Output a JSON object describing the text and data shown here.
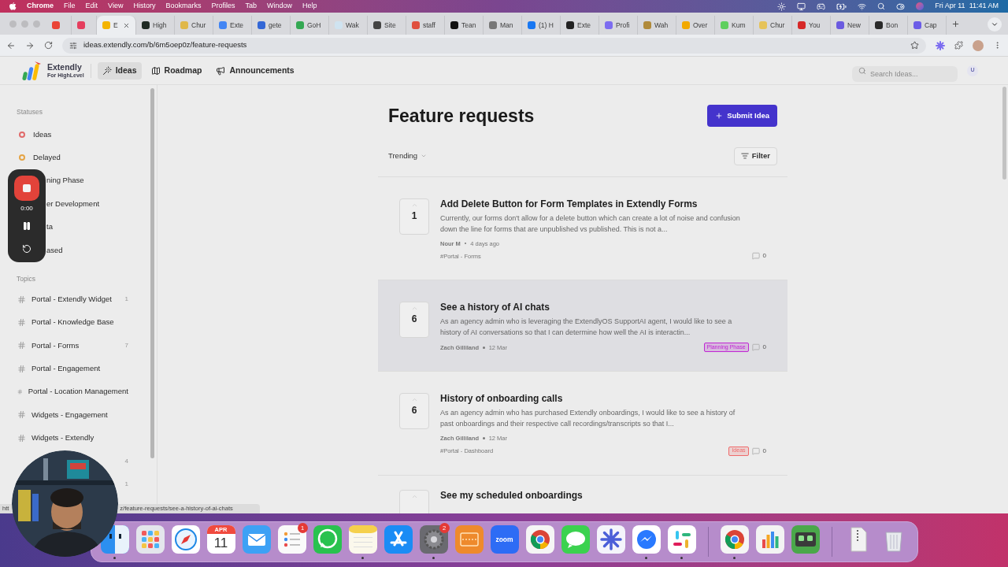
{
  "menu_bar": {
    "app": "Chrome",
    "menus": [
      "File",
      "Edit",
      "View",
      "History",
      "Bookmarks",
      "Profiles",
      "Tab",
      "Window",
      "Help"
    ],
    "clock": "Fri Apr 11  11:41 AM"
  },
  "tabs": [
    {
      "selected": false,
      "color": "#ea4335"
    },
    {
      "selected": false,
      "color": "#e53e5e"
    },
    {
      "title": "E",
      "selected": true,
      "color": "#f4b400"
    },
    {
      "title": "High",
      "selected": false,
      "color": "#1f2a24"
    },
    {
      "title": "Chur",
      "selected": false,
      "color": "#e0b84a"
    },
    {
      "title": "Exte",
      "selected": false,
      "color": "#4285f4"
    },
    {
      "title": "gete",
      "selected": false,
      "color": "#3367d6"
    },
    {
      "title": "GoH",
      "selected": false,
      "color": "#34a853"
    },
    {
      "title": "Wak",
      "selected": false,
      "color": "#cfe3f0"
    },
    {
      "title": "Site",
      "selected": false,
      "color": "#444444"
    },
    {
      "title": "staff",
      "selected": false,
      "color": "#e0503f"
    },
    {
      "title": "Tean",
      "selected": false,
      "color": "#111111"
    },
    {
      "title": "Man",
      "selected": false,
      "color": "#777777"
    },
    {
      "title": "(1) H",
      "selected": false,
      "color": "#1877f2"
    },
    {
      "title": "Exte",
      "selected": false,
      "color": "#222222"
    },
    {
      "title": "Profi",
      "selected": false,
      "color": "#7c6cf0"
    },
    {
      "title": "Wah",
      "selected": false,
      "color": "#b08a3a"
    },
    {
      "title": "Over",
      "selected": false,
      "color": "#f2a900"
    },
    {
      "title": "Kum",
      "selected": false,
      "color": "#5ecf5e"
    },
    {
      "title": "Chur",
      "selected": false,
      "color": "#e6c35a"
    },
    {
      "title": "You",
      "selected": false,
      "color": "#d62828"
    },
    {
      "title": "New",
      "selected": false,
      "color": "#6a5ae0"
    },
    {
      "title": "Bon",
      "selected": false,
      "color": "#2a2a2a"
    },
    {
      "title": "Cap",
      "selected": false,
      "color": "#6b5ce7"
    }
  ],
  "address_bar": {
    "url": "ideas.extendly.com/b/6m5oep0z/feature-requests"
  },
  "header": {
    "logo": {
      "name": "Extendly",
      "tagline": "For HighLevel"
    },
    "nav": [
      {
        "label": "Ideas",
        "kind": "wand",
        "selected": true
      },
      {
        "label": "Roadmap",
        "kind": "map",
        "selected": false
      },
      {
        "label": "Announcements",
        "kind": "megaphone",
        "selected": false
      }
    ],
    "search": {
      "placeholder": "Search Ideas..."
    },
    "avatar": "U"
  },
  "sidebar": {
    "statuses_heading": "Statuses",
    "statuses": [
      {
        "kind": "status",
        "label": "Ideas",
        "color": "#e06a6a"
      },
      {
        "kind": "status",
        "label": "Delayed",
        "color": "#e5a445"
      },
      {
        "kind": "partial",
        "label": "ning Phase"
      },
      {
        "kind": "partial",
        "label": "er Development"
      },
      {
        "kind": "partial",
        "label": "ta"
      },
      {
        "kind": "partial",
        "label": "ased"
      }
    ],
    "topics_heading": "Topics",
    "topics": [
      {
        "label": "Portal - Extendly Widget",
        "count": "1"
      },
      {
        "label": "Portal - Knowledge Base"
      },
      {
        "label": "Portal - Forms",
        "count": "7"
      },
      {
        "label": "Portal - Engagement"
      },
      {
        "label": "Portal - Location Management"
      },
      {
        "label": "Widgets - Engagement"
      },
      {
        "label": "Widgets - Extendly"
      },
      {
        "count": "4"
      },
      {
        "count": "1"
      }
    ]
  },
  "page": {
    "title": "Feature requests",
    "submit": "Submit Idea",
    "sort": "Trending",
    "filter": "Filter",
    "posts": [
      {
        "votes": "1",
        "title": "Add Delete Button for Form Templates in Extendly Forms",
        "description": "Currently, our forms don't allow for a delete button which can create a lot of noise and confusion down the line for forms that are unpublished vs published. This is not a...",
        "author": "Nour M",
        "date": "4 days ago",
        "topic": "#Portal - Forms",
        "comments": "0",
        "highlighted": false
      },
      {
        "votes": "6",
        "title": "See a history of AI chats",
        "description": "As an agency admin who is leveraging the ExtendlyOS SupportAI agent, I would like to see a history of AI conversations so that I can determine how well the AI is interactin...",
        "author": "Zach Gilliland",
        "date": "12 Mar",
        "status": {
          "label": "Planning Phase",
          "color": "#c026d3"
        },
        "comments": "0",
        "highlighted": true
      },
      {
        "votes": "6",
        "title": "History of onboarding calls",
        "description": "As an agency admin who has purchased Extendly onboardings, I would like to see a history of past onboardings and their respective call recordings/transcripts so that I...",
        "author": "Zach Gilliland",
        "date": "12 Mar",
        "topic": "#Portal - Dashboard",
        "status": {
          "label": "Ideas",
          "color": "#ef6b6b"
        },
        "comments": "0",
        "highlighted": false
      },
      {
        "title": "See my scheduled onboardings",
        "highlighted": false
      }
    ]
  },
  "recorder": {
    "time": "0:00"
  },
  "link_preview": {
    "start": "htt",
    "end": "z/feature-requests/see-a-history-of-ai-chats"
  },
  "dock": {
    "groups": [
      [
        {
          "kind": "finder",
          "running": true
        },
        {
          "kind": "launchpad",
          "running": false
        },
        {
          "kind": "safari",
          "running": false
        },
        {
          "kind": "calendar",
          "month": "APR",
          "day": "11",
          "running": false
        },
        {
          "kind": "mail",
          "running": false
        },
        {
          "kind": "reminders",
          "badge": "1",
          "running": false
        },
        {
          "kind": "whatsapp",
          "running": false
        },
        {
          "kind": "notes",
          "running": true
        },
        {
          "kind": "appstore",
          "running": false
        },
        {
          "kind": "settings",
          "badge": "2",
          "running": true
        },
        {
          "kind": "orange",
          "running": false
        },
        {
          "kind": "zoom",
          "label": "zoom",
          "running": false
        },
        {
          "kind": "chrome",
          "running": false
        },
        {
          "kind": "messages",
          "running": false
        },
        {
          "kind": "flower",
          "running": false
        },
        {
          "kind": "messenger",
          "running": true
        },
        {
          "kind": "slack",
          "running": true
        }
      ],
      [
        {
          "kind": "chrome",
          "running": true
        },
        {
          "kind": "chart",
          "running": false
        },
        {
          "kind": "robot",
          "running": false
        }
      ],
      [
        {
          "kind": "archive",
          "running": false
        },
        {
          "kind": "trash",
          "running": false
        }
      ]
    ]
  }
}
